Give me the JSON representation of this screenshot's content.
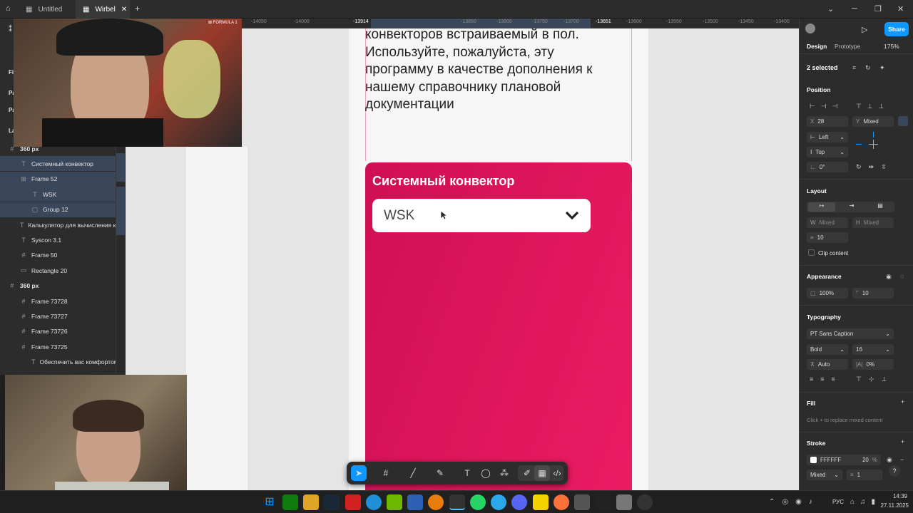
{
  "tabs": [
    {
      "label": "Untitled"
    },
    {
      "label": "Wirbel"
    }
  ],
  "ruler": {
    "labels": [
      "-14050",
      "-14000",
      "-13914",
      "-13850",
      "-13800",
      "-13750",
      "-13700",
      "-13651",
      "-13600",
      "-13550",
      "-13500",
      "-13450",
      "-13400"
    ]
  },
  "layers": {
    "items": [
      {
        "icon": "#",
        "label": "360 px",
        "indent": 0,
        "selected": false
      },
      {
        "icon": "T",
        "label": "Системный конвектор",
        "indent": 1,
        "selected": true
      },
      {
        "icon": "⊞",
        "label": "Frame 52",
        "indent": 1,
        "selected": true
      },
      {
        "icon": "T",
        "label": "WSK",
        "indent": 2,
        "selected": true
      },
      {
        "icon": "▢",
        "label": "Group 12",
        "indent": 2,
        "selected": true
      },
      {
        "icon": "T",
        "label": "Калькулятор для вычисления ко",
        "indent": 1,
        "selected": false
      },
      {
        "icon": "T",
        "label": "Syscon 3.1",
        "indent": 1,
        "selected": false
      },
      {
        "icon": "#",
        "label": "Frame 50",
        "indent": 1,
        "selected": false
      },
      {
        "icon": "▭",
        "label": "Rectangle 20",
        "indent": 1,
        "selected": false
      },
      {
        "icon": "#",
        "label": "360 px",
        "indent": 0,
        "selected": false
      },
      {
        "icon": "#",
        "label": "Frame 73728",
        "indent": 1,
        "selected": false
      },
      {
        "icon": "#",
        "label": "Frame 73727",
        "indent": 1,
        "selected": false
      },
      {
        "icon": "#",
        "label": "Frame 73726",
        "indent": 1,
        "selected": false
      },
      {
        "icon": "#",
        "label": "Frame 73725",
        "indent": 1,
        "selected": false
      },
      {
        "icon": "T",
        "label": "Обеспечить вас комфортом",
        "indent": 2,
        "selected": false
      }
    ],
    "side_labels": [
      "Fi",
      "Pa",
      "Pa",
      "La"
    ]
  },
  "canvas": {
    "paragraph_lines": [
      "конвекторов встраиваемый в пол.",
      "Используйте, пожалуйста, эту",
      "программу в качестве дополнения к",
      "нашему справочнику плановой",
      "документации"
    ],
    "card_title": "Системный конвектор",
    "dropdown_value": "WSK",
    "colors": {
      "card_top": "#d6155a",
      "card_bottom": "#e8195f"
    }
  },
  "design_panel": {
    "tab_design": "Design",
    "tab_prototype": "Prototype",
    "zoom": "175%",
    "share": "Share",
    "selection": "2 selected",
    "position": {
      "title": "Position",
      "x_label": "X",
      "x_value": "28",
      "y_label": "Y",
      "y_value": "Mixed",
      "h_constraint": "Left",
      "v_constraint": "Top",
      "rotation": "0°"
    },
    "layout": {
      "title": "Layout",
      "w_label": "W",
      "w_value": "Mixed",
      "h_label": "H",
      "h_value": "Mixed",
      "gap": "10",
      "clip": "Clip content"
    },
    "appearance": {
      "title": "Appearance",
      "opacity": "100%",
      "radius": "10"
    },
    "typography": {
      "title": "Typography",
      "font": "PT Sans Caption",
      "weight": "Bold",
      "size": "16",
      "line_height": "Auto",
      "letter_spacing": "0%"
    },
    "fill": {
      "title": "Fill",
      "hint": "Click + to replace mixed content"
    },
    "stroke": {
      "title": "Stroke",
      "color": "FFFFFF",
      "opacity": "20",
      "percent": "%",
      "position": "Mixed",
      "weight": "1"
    }
  },
  "taskbar": {
    "lang": "РУС",
    "time": "14:39",
    "date": "27.11.2025"
  }
}
